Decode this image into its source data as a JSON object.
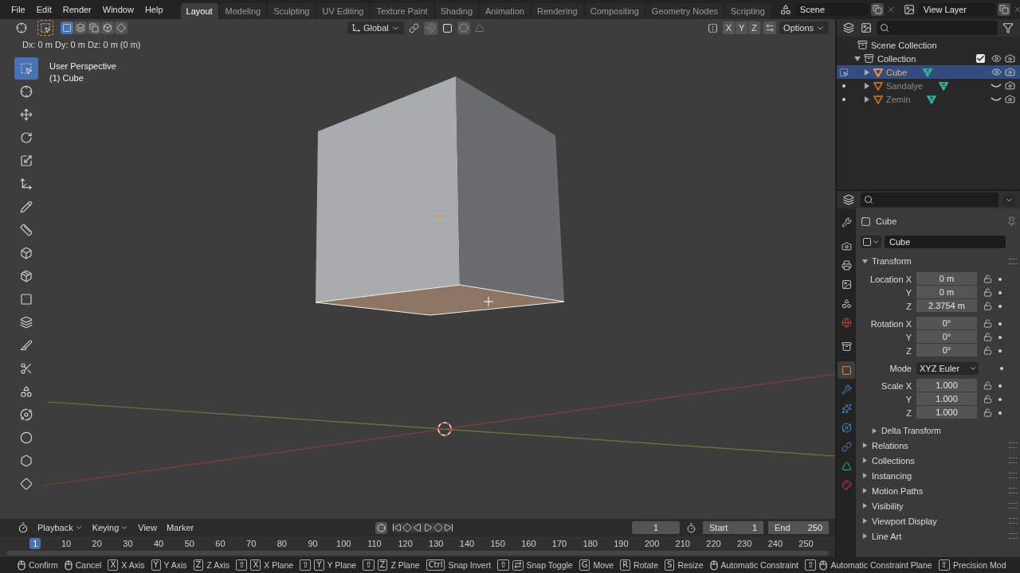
{
  "menu": [
    "File",
    "Edit",
    "Render",
    "Window",
    "Help"
  ],
  "workspaces": [
    {
      "label": "Layout",
      "selected": true
    },
    {
      "label": "Modeling",
      "selected": false
    },
    {
      "label": "Sculpting",
      "selected": false
    },
    {
      "label": "UV Editing",
      "selected": false
    },
    {
      "label": "Texture Paint",
      "selected": false
    },
    {
      "label": "Shading",
      "selected": false
    },
    {
      "label": "Animation",
      "selected": false
    },
    {
      "label": "Rendering",
      "selected": false
    },
    {
      "label": "Compositing",
      "selected": false
    },
    {
      "label": "Geometry Nodes",
      "selected": false
    },
    {
      "label": "Scripting",
      "selected": false
    }
  ],
  "scene": "Scene",
  "view_layer": "View Layer",
  "viewport": {
    "select_modes": [
      {
        "selected": true
      },
      {
        "selected": false
      },
      {
        "selected": false
      },
      {
        "selected": false
      },
      {
        "selected": false
      }
    ],
    "orientation": "Global",
    "axes": [
      "X",
      "Y",
      "Z"
    ],
    "options": "Options",
    "info": "Dx: 0 m  Dy: 0 m  Dz: 0 m (0 m)",
    "overlay": [
      "User Perspective",
      "(1) Cube"
    ],
    "tools": [
      {
        "kind": "select",
        "selected": true
      },
      {
        "kind": "cursor",
        "selected": false
      },
      {
        "kind": "move",
        "selected": false
      },
      {
        "kind": "rotate",
        "selected": false
      },
      {
        "kind": "scale",
        "selected": false
      },
      {
        "kind": "transform",
        "selected": false
      },
      {
        "kind": "annotate",
        "selected": false
      },
      {
        "kind": "measure",
        "selected": false
      },
      {
        "kind": "add-cube",
        "selected": false
      },
      {
        "kind": "extrude",
        "selected": false
      },
      {
        "kind": "inset",
        "selected": false
      },
      {
        "kind": "bevel",
        "selected": false
      },
      {
        "kind": "loop-cut",
        "selected": false
      },
      {
        "kind": "knife",
        "selected": false
      },
      {
        "kind": "poly-build",
        "selected": false
      },
      {
        "kind": "spin",
        "selected": false
      },
      {
        "kind": "smooth",
        "selected": false
      },
      {
        "kind": "shrink",
        "selected": false
      },
      {
        "kind": "shear",
        "selected": false
      }
    ]
  },
  "outliner": [
    {
      "label": "Scene Collection",
      "kind": "scene",
      "children": [
        {
          "label": "Collection",
          "kind": "collection",
          "expanded": true,
          "checked": true,
          "visible": true,
          "children": [
            {
              "label": "Cube",
              "kind": "mesh",
              "expanded": false,
              "selected": true,
              "visible": true
            },
            {
              "label": "Sandalye",
              "kind": "mesh",
              "expanded": false,
              "selected": false,
              "visible": false
            },
            {
              "label": "Zemin",
              "kind": "mesh",
              "expanded": false,
              "selected": false,
              "visible": false
            }
          ]
        }
      ]
    }
  ],
  "properties": {
    "tabs": [
      {
        "kind": "tool",
        "selected": false
      },
      {
        "kind": "render",
        "selected": false
      },
      {
        "kind": "output",
        "selected": false
      },
      {
        "kind": "view-layer",
        "selected": false
      },
      {
        "kind": "scene",
        "selected": false
      },
      {
        "kind": "world",
        "selected": false
      },
      {
        "kind": "collection",
        "selected": false
      },
      {
        "kind": "object",
        "selected": true
      },
      {
        "kind": "modifier",
        "selected": false
      },
      {
        "kind": "particles",
        "selected": false
      },
      {
        "kind": "physics",
        "selected": false
      },
      {
        "kind": "constraints",
        "selected": false
      },
      {
        "kind": "data",
        "selected": false
      },
      {
        "kind": "material",
        "selected": false
      }
    ],
    "context": "Cube",
    "name": "Cube",
    "transform": {
      "title": "Transform",
      "expanded": true,
      "groups": [
        {
          "kind": "vector",
          "rows": [
            {
              "label": "Location X",
              "value": "0 m"
            },
            {
              "label": "Y",
              "value": "0 m"
            },
            {
              "label": "Z",
              "value": "2.3754 m"
            }
          ]
        },
        {
          "kind": "vector",
          "rows": [
            {
              "label": "Rotation X",
              "value": "0°"
            },
            {
              "label": "Y",
              "value": "0°"
            },
            {
              "label": "Z",
              "value": "0°"
            }
          ]
        },
        {
          "kind": "dropdown",
          "rows": [
            {
              "label": "Mode",
              "value": "XYZ Euler"
            }
          ]
        },
        {
          "kind": "vector",
          "rows": [
            {
              "label": "Scale X",
              "value": "1.000"
            },
            {
              "label": "Y",
              "value": "1.000"
            },
            {
              "label": "Z",
              "value": "1.000"
            }
          ]
        }
      ],
      "subpanels": [
        {
          "label": "Delta Transform",
          "expanded": false
        }
      ]
    },
    "panels": [
      {
        "label": "Relations",
        "expanded": false
      },
      {
        "label": "Collections",
        "expanded": false
      },
      {
        "label": "Instancing",
        "expanded": false
      },
      {
        "label": "Motion Paths",
        "expanded": false
      },
      {
        "label": "Visibility",
        "expanded": false
      },
      {
        "label": "Viewport Display",
        "expanded": false
      },
      {
        "label": "Line Art",
        "expanded": false
      }
    ]
  },
  "timeline": {
    "menus": [
      {
        "label": "Playback",
        "dropdown": true
      },
      {
        "label": "Keying",
        "dropdown": true
      },
      {
        "label": "View",
        "dropdown": false
      },
      {
        "label": "Marker",
        "dropdown": false
      }
    ],
    "current": "1",
    "start_label": "Start",
    "start": "1",
    "end_label": "End",
    "end": "250",
    "ticks": [
      {
        "label": "1",
        "selected": true
      },
      {
        "label": "10",
        "selected": false
      },
      {
        "label": "20",
        "selected": false
      },
      {
        "label": "30",
        "selected": false
      },
      {
        "label": "40",
        "selected": false
      },
      {
        "label": "50",
        "selected": false
      },
      {
        "label": "60",
        "selected": false
      },
      {
        "label": "70",
        "selected": false
      },
      {
        "label": "80",
        "selected": false
      },
      {
        "label": "90",
        "selected": false
      },
      {
        "label": "100",
        "selected": false
      },
      {
        "label": "110",
        "selected": false
      },
      {
        "label": "120",
        "selected": false
      },
      {
        "label": "130",
        "selected": false
      },
      {
        "label": "140",
        "selected": false
      },
      {
        "label": "150",
        "selected": false
      },
      {
        "label": "160",
        "selected": false
      },
      {
        "label": "170",
        "selected": false
      },
      {
        "label": "180",
        "selected": false
      },
      {
        "label": "190",
        "selected": false
      },
      {
        "label": "200",
        "selected": false
      },
      {
        "label": "210",
        "selected": false
      },
      {
        "label": "220",
        "selected": false
      },
      {
        "label": "230",
        "selected": false
      },
      {
        "label": "240",
        "selected": false
      },
      {
        "label": "250",
        "selected": false
      }
    ]
  },
  "status": [
    {
      "label": "Confirm",
      "keys": [
        {
          "kind": "mouse"
        }
      ]
    },
    {
      "label": "Cancel",
      "keys": [
        {
          "kind": "mouse"
        }
      ]
    },
    {
      "label": "X Axis",
      "keys": [
        {
          "kind": "key",
          "text": "X"
        }
      ]
    },
    {
      "label": "Y Axis",
      "keys": [
        {
          "kind": "key",
          "text": "Y"
        }
      ]
    },
    {
      "label": "Z Axis",
      "keys": [
        {
          "kind": "key",
          "text": "Z"
        }
      ]
    },
    {
      "label": "X Plane",
      "keys": [
        {
          "kind": "key",
          "text": "⇧"
        },
        {
          "kind": "key",
          "text": "X"
        }
      ]
    },
    {
      "label": "Y Plane",
      "keys": [
        {
          "kind": "key",
          "text": "⇧"
        },
        {
          "kind": "key",
          "text": "Y"
        }
      ]
    },
    {
      "label": "Z Plane",
      "keys": [
        {
          "kind": "key",
          "text": "⇧"
        },
        {
          "kind": "key",
          "text": "Z"
        }
      ]
    },
    {
      "label": "Snap Invert",
      "keys": [
        {
          "kind": "key",
          "text": "Ctrl"
        }
      ]
    },
    {
      "label": "Snap Toggle",
      "keys": [
        {
          "kind": "key",
          "text": "⇧"
        },
        {
          "kind": "tab"
        }
      ]
    },
    {
      "label": "Move",
      "keys": [
        {
          "kind": "key",
          "text": "G"
        }
      ]
    },
    {
      "label": "Rotate",
      "keys": [
        {
          "kind": "key",
          "text": "R"
        }
      ]
    },
    {
      "label": "Resize",
      "keys": [
        {
          "kind": "key",
          "text": "S"
        }
      ]
    },
    {
      "label": "Automatic Constraint",
      "keys": [
        {
          "kind": "mouse"
        }
      ]
    },
    {
      "label": "Automatic Constraint Plane",
      "keys": [
        {
          "kind": "key",
          "text": "⇧"
        },
        {
          "kind": "mouse"
        }
      ]
    },
    {
      "label": "Precision Mod",
      "keys": [
        {
          "kind": "key",
          "text": "⇧"
        }
      ]
    }
  ]
}
